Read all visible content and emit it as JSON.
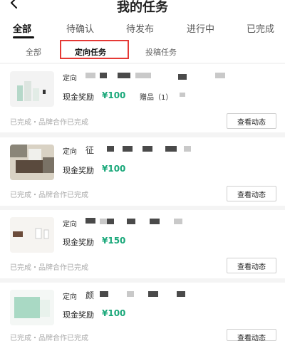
{
  "header": {
    "title": "我的任务",
    "back_icon": "chevron-left-icon"
  },
  "main_tabs": [
    "全部",
    "待确认",
    "待发布",
    "进行中",
    "已完成"
  ],
  "sub_tabs": [
    "全部",
    "定向任务",
    "投稿任务"
  ],
  "tasks": [
    {
      "tag": "定向",
      "title_prefix": "",
      "reward_label": "现金奖励",
      "reward_value": "¥100",
      "gift": "赠品（1）",
      "status": "已完成・品牌合作已完成",
      "button": "查看动态"
    },
    {
      "tag": "定向",
      "title_prefix": "征",
      "reward_label": "现金奖励",
      "reward_value": "¥100",
      "status": "已完成・品牌合作已完成",
      "button": "查看动态"
    },
    {
      "tag": "定向",
      "title_prefix": "",
      "reward_label": "现金奖励",
      "reward_value": "¥150",
      "status": "已完成・品牌合作已完成",
      "button": "查看动态"
    },
    {
      "tag": "定向",
      "title_prefix": "颜",
      "reward_label": "现金奖励",
      "reward_value": "¥100",
      "status": "已完成・品牌合作已完成",
      "button": "查看动态"
    }
  ],
  "colors": {
    "annotation": "#e53935",
    "reward": "#1aa87a"
  }
}
